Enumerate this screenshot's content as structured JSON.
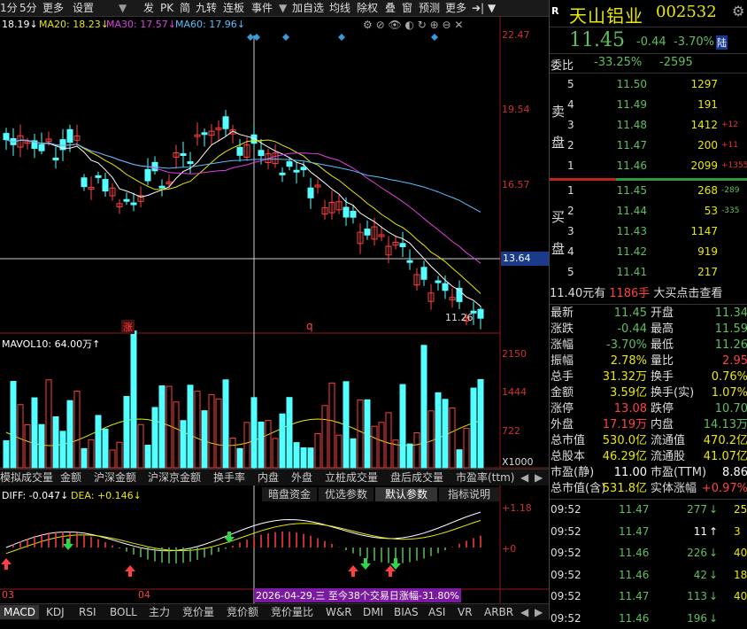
{
  "toolbar": {
    "items": [
      "1分",
      "5分",
      "更多",
      "设置",
      "发",
      "PK",
      "简",
      "九转",
      "连板",
      "事件",
      "加自选",
      "均线",
      "除权",
      "叠",
      "窗",
      "预测",
      "更多"
    ]
  },
  "ma_line": {
    "ma10": "18.19↓",
    "ma20": "MA20: 18.23↓",
    "ma30": "MA30: 17.57↓",
    "ma60": "MA60: 17.96↓"
  },
  "price_axis": [
    "22.47",
    "19.54",
    "16.57",
    "13.64"
  ],
  "current_price_label": "13.64",
  "low_label": "11.26",
  "markers": {
    "zhang": "涨",
    "q": "q"
  },
  "volume": {
    "title": "MAVOL10: 64.00万↑",
    "axis": [
      "2150",
      "1444",
      "722",
      "X1000"
    ]
  },
  "lower_tabs": [
    "模拟成交量",
    "金额",
    "沪深金额",
    "沪深京金额",
    "换手率",
    "内盘",
    "外盘",
    "立桩成交量",
    "盘后成交量",
    "市盈率(ttm)"
  ],
  "macd_line": {
    "diff": "DIFF: -0.047↓",
    "dea": "DEA: +0.146↓"
  },
  "macd_buttons": [
    "暗盘资金",
    "优选参数",
    "默认参数",
    "指标说明"
  ],
  "macd_axis": [
    "+1.18",
    "+0"
  ],
  "date_labels": [
    "03",
    "04"
  ],
  "range_note": "2026-04-29,三 至今38个交易日涨幅-31.80%",
  "bottom_tabs": [
    "MACD",
    "KDJ",
    "RSI",
    "BOLL",
    "主力",
    "竞价量",
    "竞价额",
    "竞价量比",
    "W&R",
    "DMI",
    "BIAS",
    "ASI",
    "VR",
    "ARBR"
  ],
  "stock": {
    "name": "天山铝业",
    "code": "002532",
    "price": "11.45",
    "change": "-0.44",
    "change_pct": "-3.70%",
    "exchange_badge": "陆",
    "weibi_label": "委比",
    "weibi": "-33.25%",
    "weicha": "-2595"
  },
  "sell_label": [
    "卖",
    "盘"
  ],
  "buy_label": [
    "买",
    "盘"
  ],
  "sell_orders": [
    {
      "lvl": "5",
      "price": "11.50",
      "vol": "1297",
      "delta": ""
    },
    {
      "lvl": "4",
      "price": "11.49",
      "vol": "191",
      "delta": ""
    },
    {
      "lvl": "3",
      "price": "11.48",
      "vol": "1412",
      "delta": "+12"
    },
    {
      "lvl": "2",
      "price": "11.47",
      "vol": "200",
      "delta": "+11"
    },
    {
      "lvl": "1",
      "price": "11.46",
      "vol": "2099",
      "delta": "+1355"
    }
  ],
  "buy_orders": [
    {
      "lvl": "1",
      "price": "11.45",
      "vol": "268",
      "delta": "-289"
    },
    {
      "lvl": "2",
      "price": "11.44",
      "vol": "53",
      "delta": "-335"
    },
    {
      "lvl": "3",
      "price": "11.43",
      "vol": "1147",
      "delta": ""
    },
    {
      "lvl": "4",
      "price": "11.42",
      "vol": "919",
      "delta": ""
    },
    {
      "lvl": "5",
      "price": "11.41",
      "vol": "217",
      "delta": ""
    }
  ],
  "big_buy": {
    "price": "11.40元有",
    "qty": "1186手",
    "text": "大买点击查看"
  },
  "quote": [
    {
      "l1": "最新",
      "v1": "11.45",
      "c1": "green",
      "l2": "开盘",
      "v2": "11.34",
      "c2": "green"
    },
    {
      "l1": "涨跌",
      "v1": "-0.44",
      "c1": "green",
      "l2": "最高",
      "v2": "11.59",
      "c2": "green"
    },
    {
      "l1": "涨幅",
      "v1": "-3.70%",
      "c1": "green",
      "l2": "最低",
      "v2": "11.26",
      "c2": "green"
    },
    {
      "l1": "振幅",
      "v1": "2.78%",
      "c1": "yellow",
      "l2": "量比",
      "v2": "2.95",
      "c2": "red"
    },
    {
      "l1": "总手",
      "v1": "31.32万",
      "c1": "yellow",
      "l2": "换手",
      "v2": "0.76%",
      "c2": "yellow"
    },
    {
      "l1": "金额",
      "v1": "3.59亿",
      "c1": "yellow",
      "l2": "换手(实)",
      "v2": "1.07%",
      "c2": "yellow"
    },
    {
      "l1": "涨停",
      "v1": "13.08",
      "c1": "red",
      "l2": "跌停",
      "v2": "10.70",
      "c2": "green"
    },
    {
      "l1": "外盘",
      "v1": "17.19万",
      "c1": "red",
      "l2": "内盘",
      "v2": "14.13万",
      "c2": "green"
    },
    {
      "l1": "总市值",
      "v1": "530.0亿",
      "c1": "yellow",
      "l2": "流通值",
      "v2": "470.2亿",
      "c2": "yellow"
    },
    {
      "l1": "总股本",
      "v1": "46.29亿",
      "c1": "yellow",
      "l2": "流通股",
      "v2": "41.07亿",
      "c2": "yellow"
    },
    {
      "l1": "市盈(静)",
      "v1": "11.00",
      "c1": "white",
      "l2": "市盈(TTM)",
      "v2": "8.86",
      "c2": "white"
    },
    {
      "l1": "总市值(含)",
      "v1": "531.8亿",
      "c1": "yellow",
      "l2": "实体涨幅",
      "v2": "+0.97%",
      "c2": "red"
    }
  ],
  "ticks": [
    {
      "time": "09:52",
      "price": "11.47",
      "vol": "277",
      "arrow": "↓",
      "cnt": "25"
    },
    {
      "time": "09:52",
      "price": "11.47",
      "vol": "11",
      "arrow": "↑",
      "cnt": "3"
    },
    {
      "time": "09:52",
      "price": "11.46",
      "vol": "226",
      "arrow": "↓",
      "cnt": "40"
    },
    {
      "time": "09:52",
      "price": "11.46",
      "vol": "42",
      "arrow": "↓",
      "cnt": "18"
    },
    {
      "time": "09:52",
      "price": "11.47",
      "vol": "113",
      "arrow": "↓",
      "cnt": "40"
    },
    {
      "time": "09:52",
      "price": "11.46",
      "vol": "196",
      "arrow": "↓",
      "cnt": ""
    }
  ],
  "colors": {
    "up": "#ff4040",
    "down": "#54ffff",
    "green": "#5fbf5f",
    "yellow": "#e8e800",
    "bg": "#000000"
  }
}
